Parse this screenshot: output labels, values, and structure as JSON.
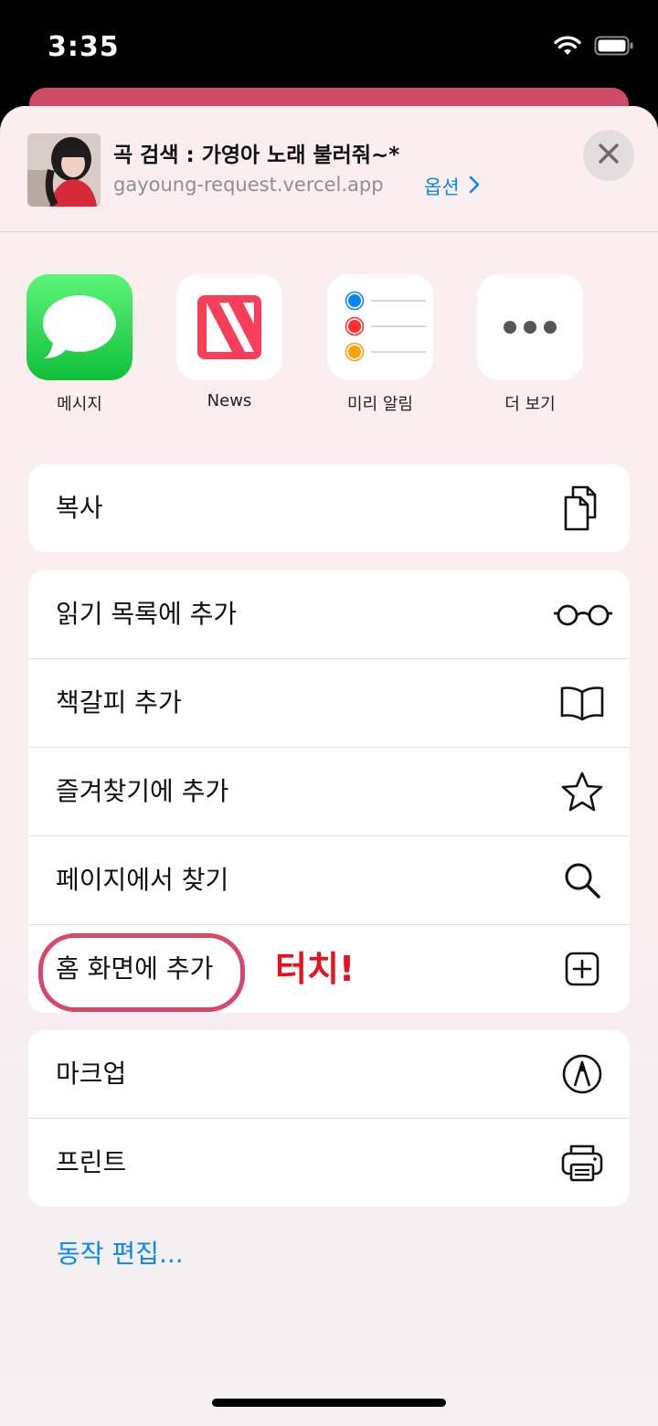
{
  "status_bar": {
    "time": "3:35"
  },
  "header": {
    "title": "곡 검색 : 가영아 노래 불러줘~*",
    "url": "gayoung-request.vercel.app",
    "options_label": "옵션"
  },
  "apps": [
    {
      "label": "메시지",
      "icon": "messages-icon"
    },
    {
      "label": "News",
      "icon": "news-icon"
    },
    {
      "label": "미리 알림",
      "icon": "reminders-icon"
    },
    {
      "label": "더 보기",
      "icon": "more-icon"
    }
  ],
  "groups": {
    "copy": [
      {
        "label": "복사",
        "icon": "copy-icon"
      }
    ],
    "page_actions": [
      {
        "label": "읽기 목록에 추가",
        "icon": "glasses-icon"
      },
      {
        "label": "책갈피 추가",
        "icon": "book-icon"
      },
      {
        "label": "즐겨찾기에 추가",
        "icon": "star-icon"
      },
      {
        "label": "페이지에서 찾기",
        "icon": "search-icon"
      },
      {
        "label": "홈 화면에 추가",
        "icon": "add-square-icon"
      }
    ],
    "extras": [
      {
        "label": "마크업",
        "icon": "markup-icon"
      },
      {
        "label": "프린트",
        "icon": "printer-icon"
      }
    ]
  },
  "annotation": {
    "touch_label": "터치!",
    "color": "#e8121e",
    "ring_color": "#d9466a"
  },
  "edit_actions_label": "동작 편집...",
  "colors": {
    "accent": "#0a84ff",
    "messages_green": "#2fd158",
    "news_red": "#fa3e5a"
  }
}
